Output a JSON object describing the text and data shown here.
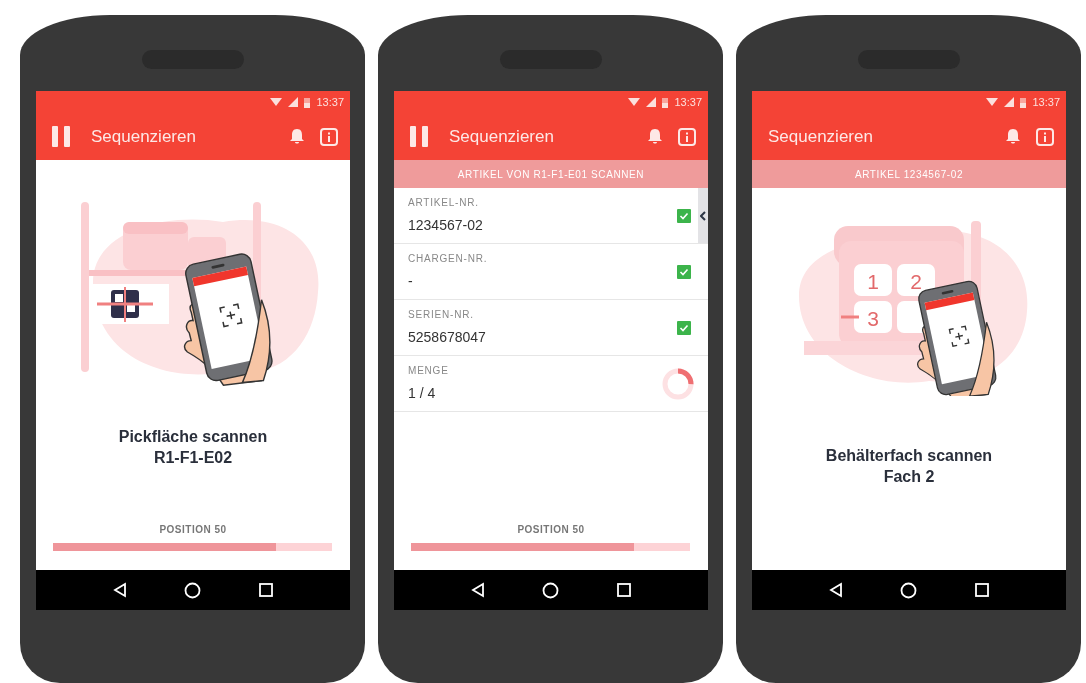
{
  "phones": [
    {
      "status_bar": {
        "time": "13:37"
      },
      "app_bar": {
        "pause_button": true,
        "title": "Sequenzieren"
      },
      "content": {
        "kind": "illustration",
        "illustration": {
          "kind": "shelf"
        },
        "instruction": "Pickfläche scannen",
        "target": "R1-F1-E02"
      },
      "footer": {
        "label": "POSITION 50",
        "level": 0.8
      }
    },
    {
      "status_bar": {
        "time": "13:37"
      },
      "app_bar": {
        "pause_button": true,
        "title": "Sequenzieren"
      },
      "banner": "ARTIKEL VON R1-F1-E01 SCANNEN",
      "content": {
        "kind": "fields",
        "drawer_handle": true,
        "fields": [
          {
            "kind": "check",
            "label": "ARTIKEL-NR.",
            "value": "1234567-02",
            "checked": true
          },
          {
            "kind": "check",
            "label": "CHARGEN-NR.",
            "value": "-",
            "checked": true
          },
          {
            "kind": "check",
            "label": "SERIEN-NR.",
            "value": "5258678047",
            "checked": true
          },
          {
            "kind": "ring",
            "label": "MENGE",
            "value": "1 / 4",
            "level": 0.25
          }
        ]
      },
      "footer": {
        "label": "POSITION 50",
        "level": 0.8
      }
    },
    {
      "status_bar": {
        "time": "13:37"
      },
      "app_bar": {
        "pause_button": false,
        "title": "Sequenzieren"
      },
      "banner": "ARTIKEL 1234567-02",
      "content": {
        "kind": "illustration",
        "illustration": {
          "kind": "bins",
          "bin_labels": [
            "1",
            "2",
            "3"
          ]
        },
        "instruction": "Behälterfach scannen",
        "target": "Fach 2"
      }
    }
  ]
}
